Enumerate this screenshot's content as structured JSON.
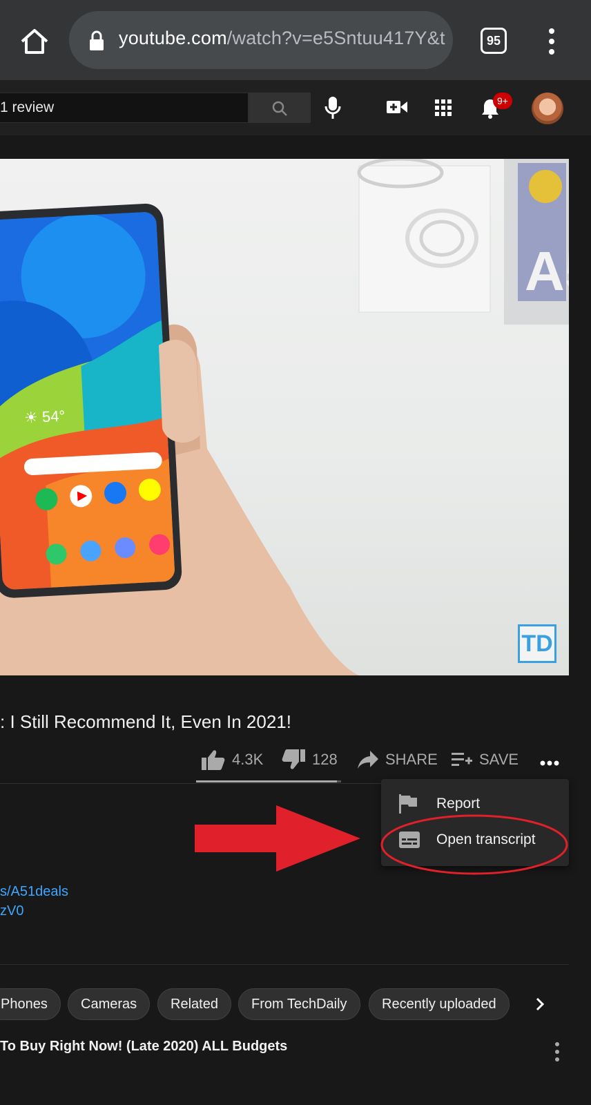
{
  "browser": {
    "url_host": "youtube.com",
    "url_path": "/watch?v=e5Sntuu417Y&t",
    "tab_count": "95"
  },
  "yt_header": {
    "search_text": "1 review",
    "notification_badge": "9+"
  },
  "player": {
    "channel_logo": "TD"
  },
  "video": {
    "title": ": I Still Recommend It, Even In 2021!",
    "likes": "4.3K",
    "dislikes": "128",
    "share_label": "SHARE",
    "save_label": "SAVE",
    "like_ratio": 0.97
  },
  "popup_menu": {
    "items": [
      {
        "label": "Report",
        "icon": "flag-icon"
      },
      {
        "label": "Open transcript",
        "icon": "transcript-icon"
      }
    ]
  },
  "description": {
    "link1": "s/A51deals",
    "link2": "zV0"
  },
  "chips": [
    "Phones",
    "Cameras",
    "Related",
    "From TechDaily",
    "Recently uploaded"
  ],
  "next_video": {
    "title": "To Buy Right Now! (Late 2020) ALL Budgets"
  },
  "colors": {
    "annotation_red": "#e0202a",
    "link_blue": "#3ea6ff",
    "badge_red": "#cc0000"
  }
}
